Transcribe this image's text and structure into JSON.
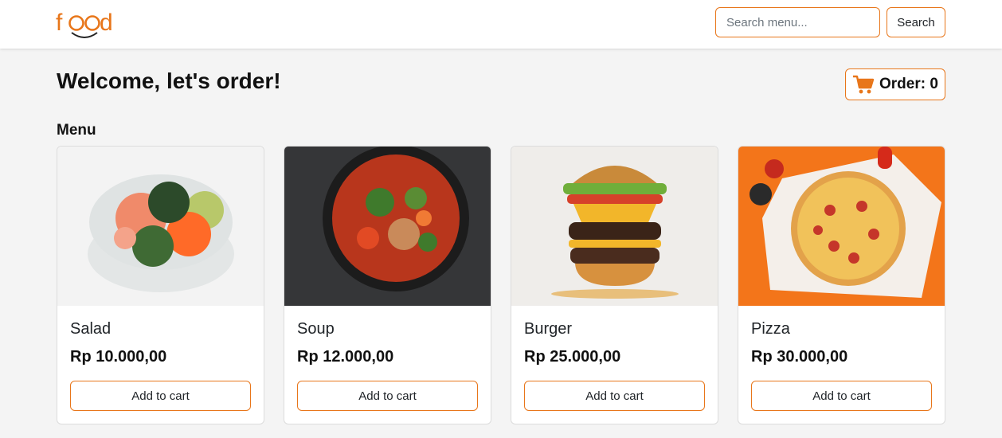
{
  "brand": {
    "logo_text": "food",
    "accent_color": "#e8761a"
  },
  "search": {
    "placeholder": "Search menu...",
    "button_label": "Search"
  },
  "header": {
    "welcome": "Welcome, let's order!",
    "order_label": "Order: 0",
    "cart_icon": "cart-icon"
  },
  "menu": {
    "title": "Menu",
    "items": [
      {
        "name": "Salad",
        "price": "Rp 10.000,00",
        "button": "Add to cart",
        "image": "salad-bowl-image"
      },
      {
        "name": "Soup",
        "price": "Rp 12.000,00",
        "button": "Add to cart",
        "image": "soup-pot-image"
      },
      {
        "name": "Burger",
        "price": "Rp 25.000,00",
        "button": "Add to cart",
        "image": "burger-image"
      },
      {
        "name": "Pizza",
        "price": "Rp 30.000,00",
        "button": "Add to cart",
        "image": "pizza-image"
      }
    ]
  }
}
